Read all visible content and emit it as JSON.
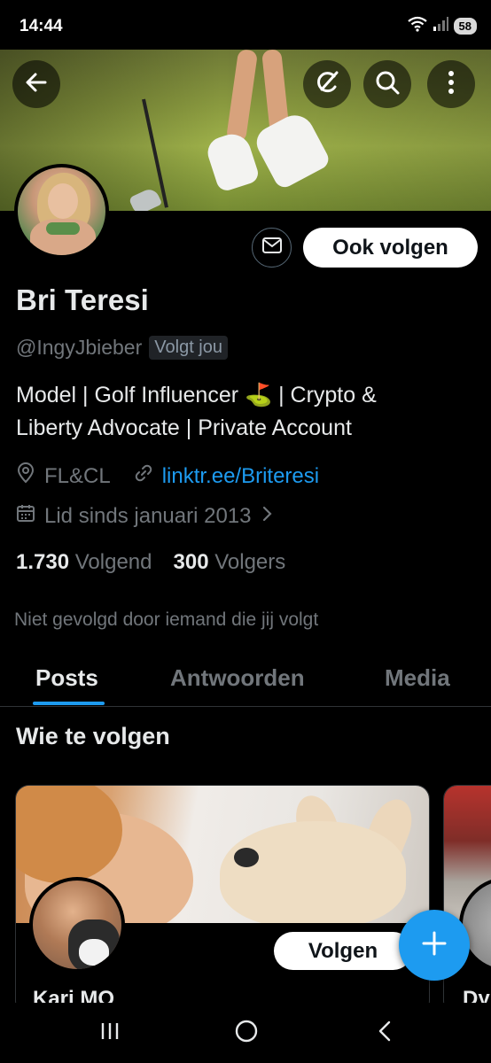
{
  "status_bar": {
    "time": "14:44",
    "battery": "58"
  },
  "profile": {
    "display_name": "Bri Teresi",
    "handle": "@IngyJbieber",
    "follows_you": "Volgt jou",
    "bio_line1": "Model | Golf Influencer ⛳ | Crypto &",
    "bio_line2": "Liberty Advocate | Private Account",
    "location": "FL&CL",
    "link": "linktr.ee/Briteresi",
    "joined": "Lid sinds januari 2013",
    "following_count": "1.730",
    "following_label": "Volgend",
    "followers_count": "300",
    "followers_label": "Volgers",
    "not_followed_text": "Niet gevolgd door iemand die jij volgt"
  },
  "actions": {
    "follow_back_label": "Ook volgen"
  },
  "tabs": [
    {
      "label": "Posts",
      "active": true
    },
    {
      "label": "Antwoorden",
      "active": false
    },
    {
      "label": "Media",
      "active": false
    }
  ],
  "who_to_follow": {
    "title": "Wie te volgen",
    "cards": [
      {
        "name": "Kari MO",
        "follow_label": "Volgen"
      },
      {
        "name": "Dy"
      }
    ]
  },
  "colors": {
    "accent": "#1d9bf0",
    "background": "#000000",
    "secondary_text": "#71767b"
  },
  "icons": {
    "back": "arrow-left-icon",
    "grok": "grok-icon",
    "search": "search-icon",
    "more": "more-vertical-icon",
    "mail": "mail-icon",
    "location": "location-pin-icon",
    "link": "link-icon",
    "calendar": "calendar-icon",
    "chevron": "chevron-right-icon",
    "compose": "plus-icon"
  }
}
